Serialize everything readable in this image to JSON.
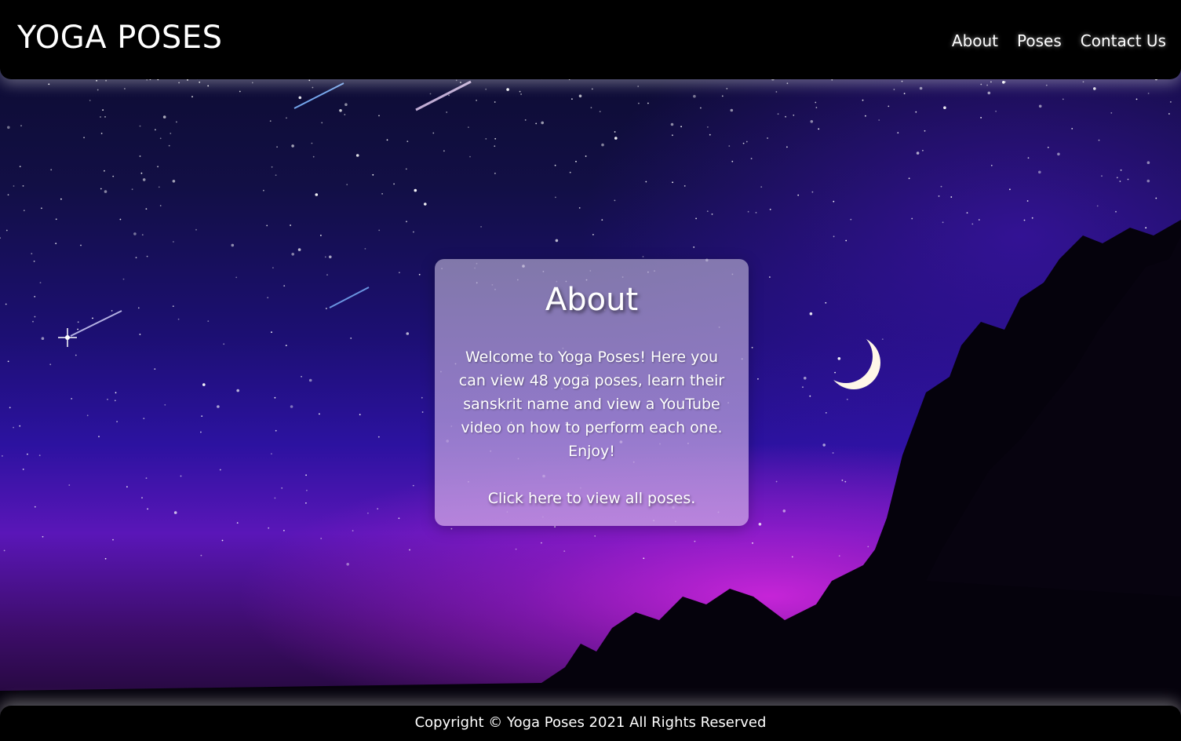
{
  "header": {
    "logo": "YOGA POSES",
    "nav": [
      {
        "label": "About"
      },
      {
        "label": "Poses"
      },
      {
        "label": "Contact Us"
      }
    ]
  },
  "about_card": {
    "title": "About",
    "body": "Welcome to Yoga Poses! Here you can view 48 yoga poses, learn their sanskrit name and view a YouTube video on how to perform each one. Enjoy!",
    "link_label": "Click here",
    "link_suffix": " to view all poses."
  },
  "footer": {
    "copyright": "Copyright © Yoga Poses 2021 All Rights Reserved"
  },
  "background": {
    "scene": "night-sky",
    "icons": [
      "stars",
      "shooting-star",
      "moon-crescent-icon",
      "tree-silhouette"
    ],
    "colors": {
      "sky_top": "#0b0a2a",
      "sky_mid": "#2c12a0",
      "horizon_glow": "#dc28e6",
      "bar": "#000000",
      "text": "#ffffff"
    }
  }
}
